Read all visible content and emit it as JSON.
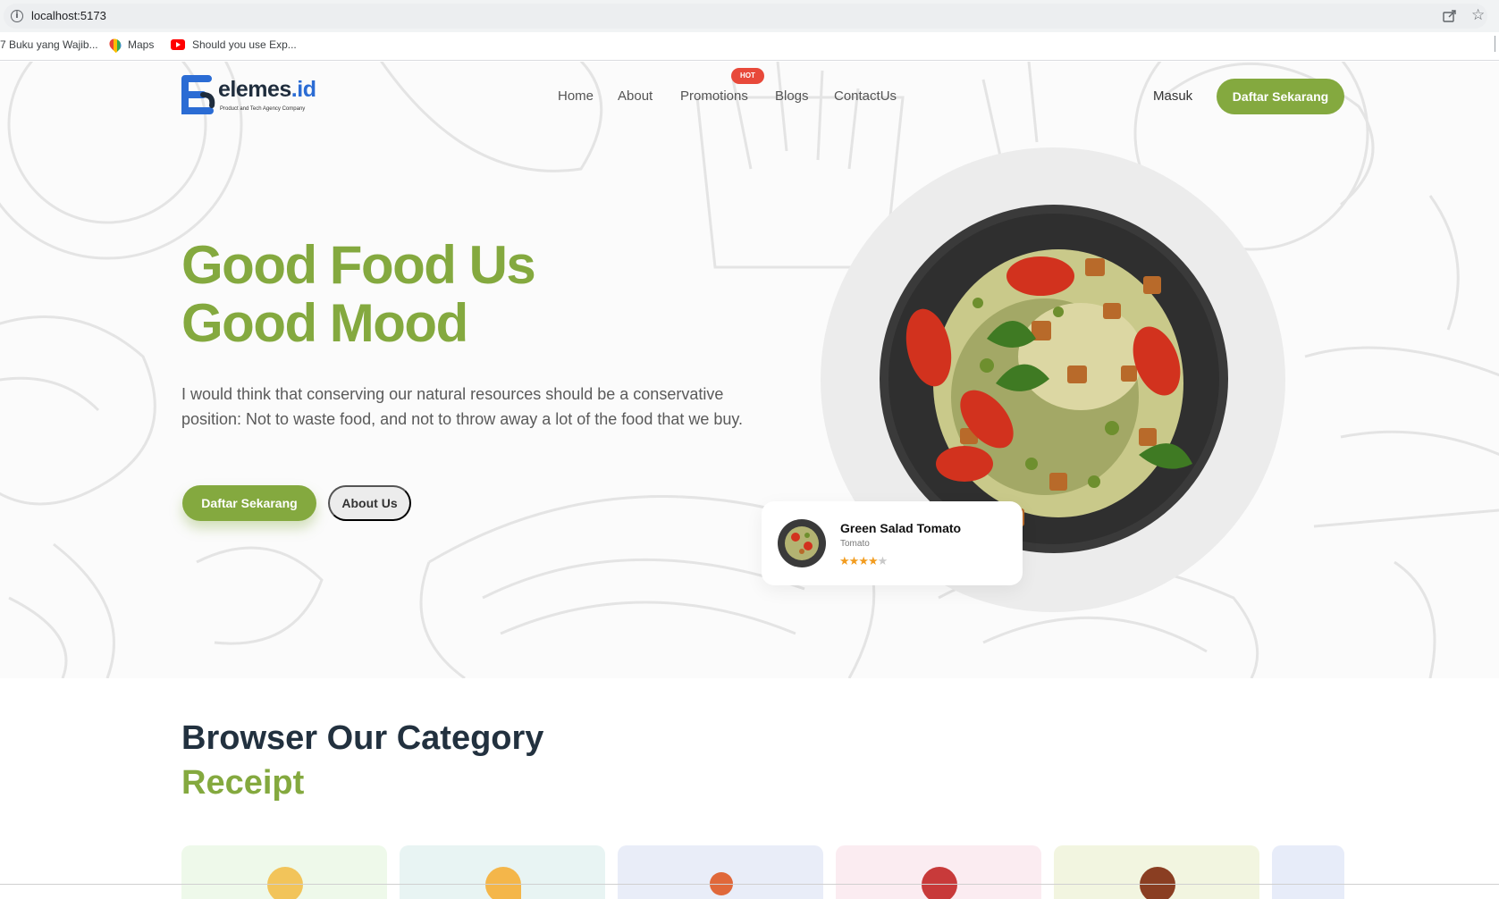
{
  "browser": {
    "url": "localhost:5173",
    "bookmarks": [
      "7 Buku yang Wajib...",
      "Maps",
      "Should you use Exp..."
    ]
  },
  "nav": {
    "logo_text": "elemes",
    "logo_text_suffix": ".id",
    "logo_subtitle": "Product and Tech Agency Company",
    "links": [
      "Home",
      "About",
      "Promotions",
      "Blogs",
      "ContactUs"
    ],
    "hot_badge": "HOT",
    "login": "Masuk",
    "cta": "Daftar Sekarang"
  },
  "hero": {
    "headline_line1": "Good Food Us",
    "headline_line2": "Good Mood",
    "description": "I would think that conserving our natural resources should be a conservative position: Not to waste food, and not to throw away a lot of the food that we buy.",
    "primary_button": "Daftar Sekarang",
    "secondary_button": "About Us",
    "card": {
      "title": "Green Salad Tomato",
      "subtitle": "Tomato",
      "rating": 4,
      "rating_max": 5
    }
  },
  "category": {
    "title": "Browser Our Category",
    "subtitle": "Receipt",
    "card_colors": [
      "#eef9ea",
      "#e8f4f3",
      "#e9edf8",
      "#fbecf1",
      "#f2f5e0",
      "#e7ecf9"
    ]
  },
  "colors": {
    "accent": "#84a93f",
    "hot": "#e8493a",
    "dark": "#22313f"
  }
}
